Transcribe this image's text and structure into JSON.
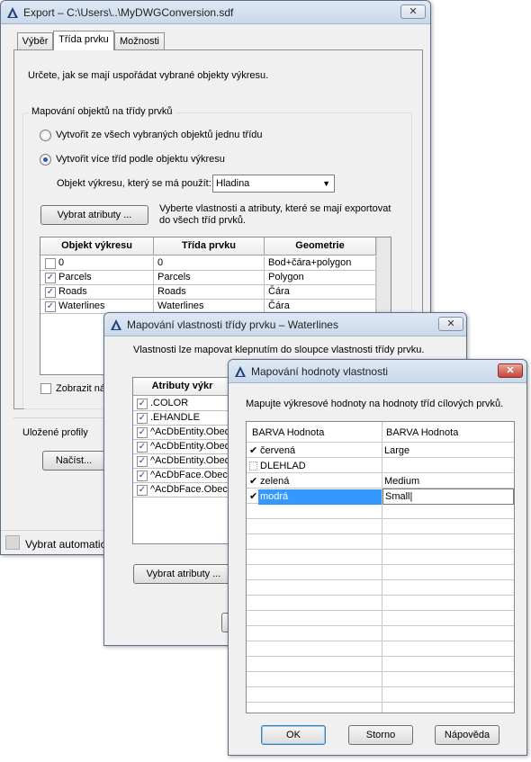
{
  "export_dialog": {
    "title": "Export – C:\\Users\\..\\MyDWGConversion.sdf",
    "tabs": [
      "Výběr",
      "Třída prvku",
      "Možnosti"
    ],
    "intro": "Určete, jak se mají uspořádat vybrané objekty výkresu.",
    "group_title": "Mapování objektů na třídy prvků",
    "radio_single": "Vytvořit ze všech vybraných objektů jednu třídu",
    "radio_multi": "Vytvořit více tříd podle objektu výkresu",
    "object_label": "Objekt výkresu, který se má použít:",
    "object_value": "Hladina",
    "select_attrs_button": "Vybrat atributy ...",
    "select_attrs_desc_1": "Vyberte vlastnosti a atributy, které se mají exportovat",
    "select_attrs_desc_2": "do všech tříd prvků.",
    "table_headers": [
      "Objekt výkresu",
      "Třída prvku",
      "Geometrie"
    ],
    "table_rows": [
      {
        "object": "0",
        "feature_class": "0",
        "geometry": "Bod+čára+polygon",
        "checked": false
      },
      {
        "object": "Parcels",
        "feature_class": "Parcels",
        "geometry": "Polygon",
        "checked": true
      },
      {
        "object": "Roads",
        "feature_class": "Roads",
        "geometry": "Čára",
        "checked": true
      },
      {
        "object": "Waterlines",
        "feature_class": "Waterlines",
        "geometry": "Čára",
        "checked": true
      }
    ],
    "show_names_cb": "Zobrazit náz",
    "saved_profiles": "Uložené profily",
    "load_button": "Načíst...",
    "status_text": "Vybrat automatic"
  },
  "property_dialog": {
    "title": "Mapování vlastnosti třídy prvku – Waterlines",
    "intro": "Vlastnosti lze mapovat klepnutím do sloupce vlastnosti třídy prvku.",
    "attr_header": "Atributy výkr",
    "attrs": [
      ".COLOR",
      ".EHANDLE",
      "^AcDbEntity.Obec",
      "^AcDbEntity.Obec",
      "^AcDbEntity.Obec",
      "^AcDbFace.Obec",
      "^AcDbFace.Obec"
    ],
    "select_attrs_button": "Vybrat atributy ..."
  },
  "value_dialog": {
    "title": "Mapování hodnoty vlastnosti",
    "intro": "Mapujte výkresové hodnoty na hodnoty tříd cílových prvků.",
    "col_headers": [
      "BARVA Hodnota",
      "BARVA Hodnota"
    ],
    "rows": [
      {
        "source": "červená",
        "target": "Large",
        "checked": true
      },
      {
        "source": "DLEHLAD",
        "target": "",
        "checked": false
      },
      {
        "source": "zelená",
        "target": "Medium",
        "checked": true
      },
      {
        "source": "modrá",
        "target": "Small",
        "checked": true,
        "selected": true
      }
    ],
    "ok_button": "OK",
    "cancel_button": "Storno",
    "help_button": "Nápověda"
  },
  "colors": {
    "window_bg": "#f0f0f0",
    "title_gradient_top": "#dfe9f5",
    "selection": "#3399ff",
    "close_red": "#c6453a"
  }
}
